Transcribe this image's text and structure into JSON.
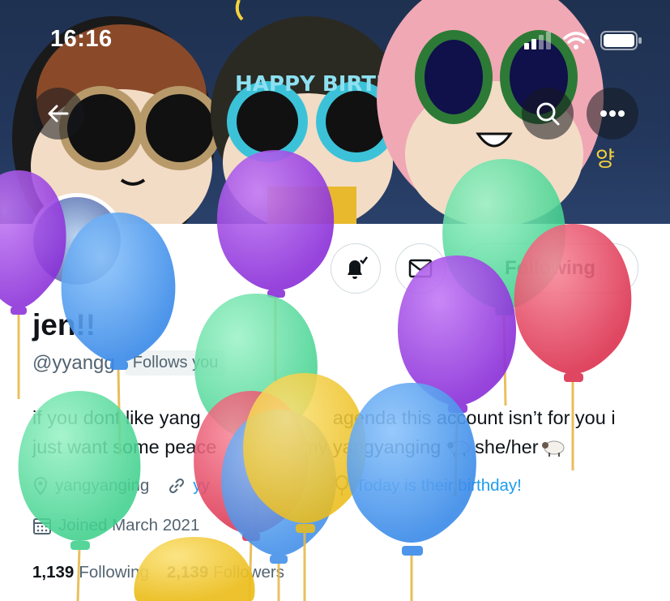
{
  "status_bar": {
    "time": "16:16"
  },
  "banner": {
    "sticker_text": "HAPPY BIRTHDAY",
    "korean_text": "양"
  },
  "profile": {
    "display_name": "jen!!",
    "handle": "@yyangg",
    "follows_you": "Follows you",
    "bio_line1": "if you dont like yang",
    "bio_agenda": "agenda this account isn’t for you i",
    "bio_line2": "just want some peace",
    "bio_and": "and my yangyanging",
    "bio_pronouns": "she/her",
    "location": "yangyanging",
    "website": "yy",
    "birthday": "Today is their birthday!",
    "joined": "Joined March 2021",
    "following_count": "1,139",
    "following_label": "Following",
    "followers_count": "2,139",
    "followers_label": "Followers"
  },
  "buttons": {
    "following": "Following"
  },
  "icons": {
    "back": "arrow-left-icon",
    "search": "search-icon",
    "more": "more-icon",
    "notify": "bell-check-icon",
    "message": "envelope-icon",
    "location": "location-pin-icon",
    "link": "link-icon",
    "balloon": "balloon-icon",
    "calendar": "calendar-icon",
    "sheep": "sheep-emoji-icon"
  },
  "colors": {
    "banner_bg": "#23375c",
    "link_blue": "#1d9bf0",
    "muted": "#536471",
    "balloon_purple": "#9b3fe0",
    "balloon_blue": "#4a9cf0",
    "balloon_green": "#57df9e",
    "balloon_red": "#e6455f",
    "balloon_yellow": "#f1cb36"
  }
}
